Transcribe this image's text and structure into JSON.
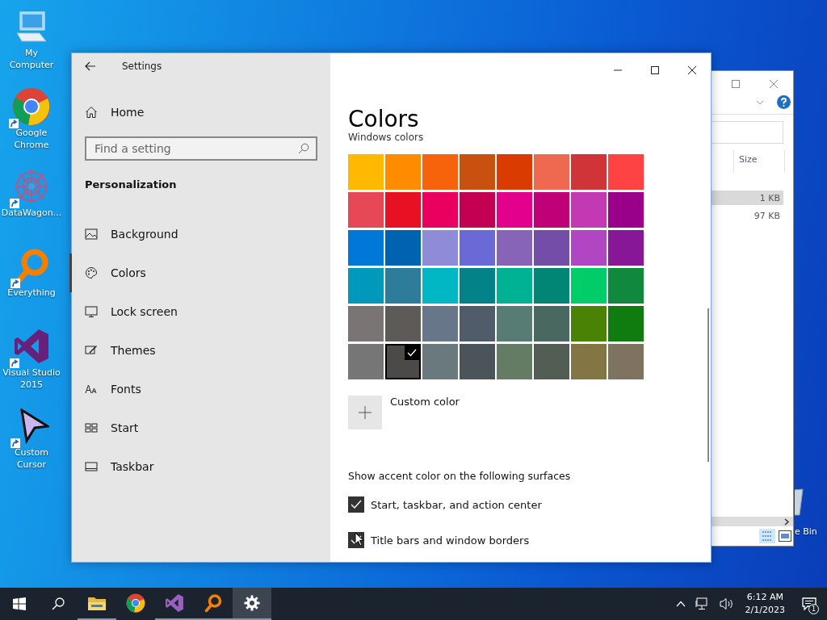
{
  "desktop_icons": [
    {
      "label": "My Computer",
      "shortcut": false
    },
    {
      "label": "Google Chrome",
      "shortcut": true
    },
    {
      "label": "DataWagon...",
      "shortcut": true
    },
    {
      "label": "Everything",
      "shortcut": true
    },
    {
      "label": "Visual Studio 2015",
      "shortcut": true
    },
    {
      "label": "Custom Cursor",
      "shortcut": true
    }
  ],
  "explorer": {
    "column_heading": "Size",
    "rows": [
      {
        "size": "1 KB",
        "selected": true
      },
      {
        "size": "97 KB",
        "selected": false
      }
    ]
  },
  "recycle_bin": {
    "label": "e Bin"
  },
  "settings": {
    "title": "Settings",
    "home": "Home",
    "search": {
      "placeholder": "Find a setting"
    },
    "section": "Personalization",
    "nav": [
      {
        "label": "Background",
        "selected": false
      },
      {
        "label": "Colors",
        "selected": true
      },
      {
        "label": "Lock screen",
        "selected": false
      },
      {
        "label": "Themes",
        "selected": false
      },
      {
        "label": "Fonts",
        "selected": false
      },
      {
        "label": "Start",
        "selected": false
      },
      {
        "label": "Taskbar",
        "selected": false
      }
    ],
    "page_title": "Colors",
    "subheading": "Windows colors",
    "swatches": [
      {
        "color": "#ffb900",
        "selected": false
      },
      {
        "color": "#ff8c00",
        "selected": false
      },
      {
        "color": "#f7630c",
        "selected": false
      },
      {
        "color": "#ca5010",
        "selected": false
      },
      {
        "color": "#da3b01",
        "selected": false
      },
      {
        "color": "#ef6950",
        "selected": false
      },
      {
        "color": "#d13438",
        "selected": false
      },
      {
        "color": "#ff4343",
        "selected": false
      },
      {
        "color": "#e74856",
        "selected": false
      },
      {
        "color": "#e81123",
        "selected": false
      },
      {
        "color": "#ea005e",
        "selected": false
      },
      {
        "color": "#c30052",
        "selected": false
      },
      {
        "color": "#e3008c",
        "selected": false
      },
      {
        "color": "#bf0077",
        "selected": false
      },
      {
        "color": "#c239b3",
        "selected": false
      },
      {
        "color": "#9a0089",
        "selected": false
      },
      {
        "color": "#0078d7",
        "selected": false
      },
      {
        "color": "#0063b1",
        "selected": false
      },
      {
        "color": "#8e8cd8",
        "selected": false
      },
      {
        "color": "#6b69d6",
        "selected": false
      },
      {
        "color": "#8764b8",
        "selected": false
      },
      {
        "color": "#744da9",
        "selected": false
      },
      {
        "color": "#b146c2",
        "selected": false
      },
      {
        "color": "#881798",
        "selected": false
      },
      {
        "color": "#0099bc",
        "selected": false
      },
      {
        "color": "#2d7d9a",
        "selected": false
      },
      {
        "color": "#00b7c3",
        "selected": false
      },
      {
        "color": "#038387",
        "selected": false
      },
      {
        "color": "#00b294",
        "selected": false
      },
      {
        "color": "#018574",
        "selected": false
      },
      {
        "color": "#00cc6a",
        "selected": false
      },
      {
        "color": "#10893e",
        "selected": false
      },
      {
        "color": "#7a7574",
        "selected": false
      },
      {
        "color": "#5d5a58",
        "selected": false
      },
      {
        "color": "#68768a",
        "selected": false
      },
      {
        "color": "#515c6b",
        "selected": false
      },
      {
        "color": "#567c73",
        "selected": false
      },
      {
        "color": "#486860",
        "selected": false
      },
      {
        "color": "#498205",
        "selected": false
      },
      {
        "color": "#107c10",
        "selected": false
      },
      {
        "color": "#767676",
        "selected": false
      },
      {
        "color": "#4c4a48",
        "selected": true
      },
      {
        "color": "#69797e",
        "selected": false
      },
      {
        "color": "#4a5459",
        "selected": false
      },
      {
        "color": "#647c64",
        "selected": false
      },
      {
        "color": "#525e54",
        "selected": false
      },
      {
        "color": "#847545",
        "selected": false
      },
      {
        "color": "#7e735f",
        "selected": false
      }
    ],
    "custom_color": "Custom color",
    "surfaces_heading": "Show accent color on the following surfaces",
    "checkboxes": [
      {
        "label": "Start, taskbar, and action center",
        "checked": true
      },
      {
        "label": "Title bars and window borders",
        "checked": true
      }
    ]
  },
  "taskbar": {
    "apps": [
      {
        "running": true,
        "selected": false
      },
      {
        "running": false,
        "selected": false
      },
      {
        "running": true,
        "selected": false
      },
      {
        "running": true,
        "selected": false
      },
      {
        "running": true,
        "selected": true
      }
    ],
    "time": "6:12 AM",
    "date": "2/1/2023",
    "notification_count": "1"
  }
}
